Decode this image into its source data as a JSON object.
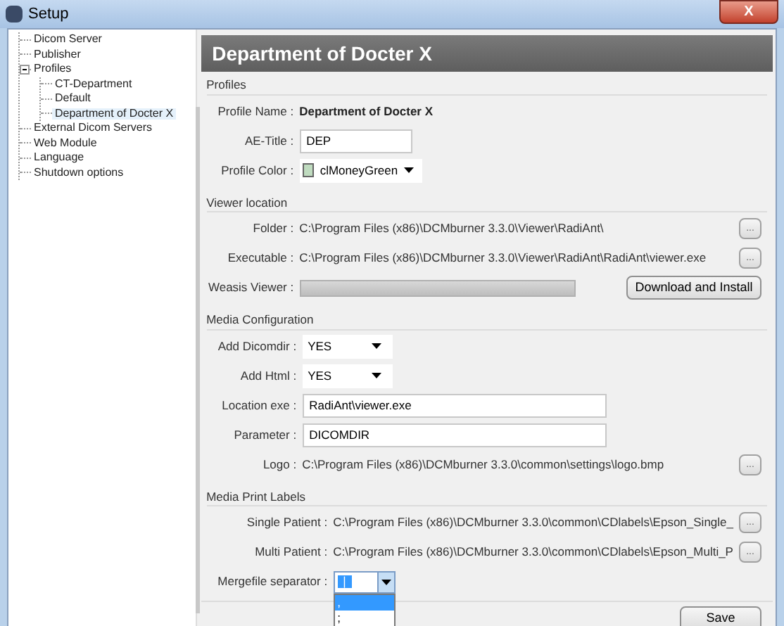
{
  "window": {
    "title": "Setup",
    "close": "X"
  },
  "sidebar": {
    "items": [
      {
        "label": "Dicom Server",
        "selected": false
      },
      {
        "label": "Publisher",
        "selected": false
      },
      {
        "label": "Profiles",
        "selected": false,
        "expanded": true,
        "children": [
          {
            "label": "CT-Department",
            "selected": false
          },
          {
            "label": "Default",
            "selected": false
          },
          {
            "label": "Department of Docter X",
            "selected": true
          }
        ]
      },
      {
        "label": "External Dicom Servers",
        "selected": false
      },
      {
        "label": "Web Module",
        "selected": false
      },
      {
        "label": "Language",
        "selected": false
      },
      {
        "label": "Shutdown options",
        "selected": false
      }
    ]
  },
  "header": {
    "title": "Department of Docter X"
  },
  "sections": [
    {
      "title": "Profiles",
      "fields": [
        {
          "kind": "static",
          "label": "Profile Name :",
          "value": "Department of Docter X"
        },
        {
          "kind": "text",
          "label": "AE-Title :",
          "value": "DEP"
        },
        {
          "kind": "color",
          "label": "Profile Color :",
          "value": "clMoneyGreen",
          "color": "#c0dcc0"
        }
      ]
    },
    {
      "title": "Viewer location",
      "fields": [
        {
          "kind": "path",
          "label": "Folder :",
          "value": "C:\\Program Files (x86)\\DCMburner 3.3.0\\Viewer\\RadiAnt\\",
          "button": "..."
        },
        {
          "kind": "path",
          "label": "Executable :",
          "value": "C:\\Program Files (x86)\\DCMburner 3.3.0\\Viewer\\RadiAnt\\RadiAnt\\viewer.exe",
          "button": "..."
        },
        {
          "kind": "progress",
          "label": "Weasis Viewer :",
          "level": 0,
          "button": "Download and Install"
        }
      ]
    },
    {
      "title": "Media Configuration",
      "fields": [
        {
          "kind": "dropdown",
          "label": "Add Dicomdir :",
          "value": "YES"
        },
        {
          "kind": "dropdown",
          "label": "Add Html :",
          "value": "YES"
        },
        {
          "kind": "text",
          "label": "Location exe :",
          "value": "RadiAnt\\viewer.exe"
        },
        {
          "kind": "text",
          "label": "Parameter :",
          "value": "DICOMDIR"
        },
        {
          "kind": "path",
          "label": "Logo :",
          "value": "C:\\Program Files (x86)\\DCMburner 3.3.0\\common\\settings\\logo.bmp",
          "button": "..."
        }
      ]
    },
    {
      "title": "Media Print Labels",
      "fields": [
        {
          "kind": "path",
          "label": "Single Patient :",
          "value": "C:\\Program Files (x86)\\DCMburner 3.3.0\\common\\CDlabels\\Epson_Single_",
          "button": "..."
        },
        {
          "kind": "path",
          "label": "Multi Patient :",
          "value": "C:\\Program Files (x86)\\DCMburner 3.3.0\\common\\CDlabels\\Epson_Multi_P",
          "button": "..."
        },
        {
          "kind": "open_dropdown",
          "label": "Mergefile separator :",
          "value": "|",
          "options": [
            {
              "label": ",",
              "selected": true
            },
            {
              "label": ";",
              "selected": false
            }
          ]
        }
      ]
    }
  ],
  "save_button": "Save"
}
